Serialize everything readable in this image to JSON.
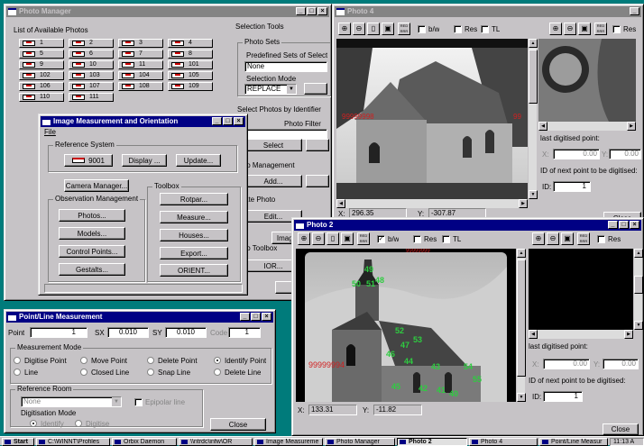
{
  "photo_manager": {
    "title": "Photo Manager",
    "list_label": "List of Available Photos",
    "photos": [
      "1",
      "2",
      "3",
      "4",
      "5",
      "6",
      "7",
      "8",
      "9",
      "10",
      "11",
      "101",
      "102",
      "103",
      "104",
      "105",
      "106",
      "107",
      "108",
      "109",
      "110",
      "111"
    ],
    "selection_tools": "Selection Tools",
    "photo_sets": "Photo Sets",
    "predefined": "Predefined Sets of Selected",
    "none_value": "None",
    "selection_mode": "Selection Mode",
    "mode_value": "REPLACE",
    "select_by_id": "Select Photos by Identifier",
    "photo_filter": "Photo Filter",
    "select_btn": "Select",
    "to_management": "to Management",
    "add_btn": "Add...",
    "ate_photo": "ate Photo",
    "edit_btn": "Edit...",
    "image_btn": "Image",
    "to_toolbox": "to Toolbox",
    "ior_btn": "IOR..."
  },
  "imo": {
    "title": "Image Measurement and Orientation",
    "menu_file": "File",
    "reference_system": "Reference System",
    "ref_id": "9001",
    "display_btn": "Display ...",
    "update_btn": "Update...",
    "camera_btn": "Camera Manager...",
    "toolbox": "Toolbox",
    "obs_mgmt": "Observation Management",
    "photos_btn": "Photos...",
    "models_btn": "Models...",
    "control_btn": "Control Points...",
    "gestalts_btn": "Gestalts...",
    "rotpar_btn": "Rotpar...",
    "measure_btn": "Measure...",
    "houses_btn": "Houses...",
    "export_btn": "Export...",
    "orient_btn": "ORIENT..."
  },
  "plm": {
    "title": "Point/Line Measurement",
    "point_label": "Point",
    "point_value": "1",
    "sx_label": "SX",
    "sx_value": "0.010",
    "sy_label": "SY",
    "sy_value": "0.010",
    "code_label": "Code",
    "code_value": "1",
    "meas_mode": "Measurement Mode",
    "modes": [
      "Digitise Point",
      "Move Point",
      "Delete Point",
      "Identify Point",
      "Line",
      "Closed Line",
      "Snap Line",
      "Delete Line"
    ],
    "ref_room": "Reference Room",
    "none_value": "None",
    "epipolar": "Epipolar line",
    "dig_mode": "Digitisation Mode",
    "identify": "Identify",
    "digitise": "Digitise",
    "close_btn": "Close"
  },
  "photo4": {
    "title": "Photo 4",
    "bw": "b/w",
    "res": "Res",
    "tl": "TL",
    "x_label": "X:",
    "x_value": "296.35",
    "y_label": "Y:",
    "y_value": "-307.87",
    "last_pt": "last digitised point:",
    "x0": "0.00",
    "y0": "0.00",
    "next_pt": "ID of next point to be digitised:",
    "id_label": "ID:",
    "id_value": "1",
    "close_btn": "Close",
    "marker_99": "99",
    "marker_red": "99999998"
  },
  "photo2": {
    "title": "Photo 2",
    "bw": "b/w",
    "res": "Res",
    "tl": "TL",
    "x_label": "X:",
    "x_value": "133.31",
    "y_label": "Y:",
    "y_value": "-11.82",
    "last_pt": "last digitised point:",
    "x0": "0.00",
    "y0": "0.00",
    "next_pt": "ID of next point to be digitised:",
    "id_label": "ID:",
    "id_value": "1",
    "close_btn": "Close",
    "marker_top": "99999999",
    "marker_left": "99999994",
    "green_labels": [
      "49",
      "50",
      "51",
      "48",
      "52",
      "47",
      "53",
      "46",
      "44",
      "43",
      "45",
      "42",
      "41",
      "40",
      "54",
      "55"
    ]
  },
  "taskbar": {
    "start": "Start",
    "items": [
      "C:\\WINNT\\Profiles",
      "Orbix Daemon",
      "\\\\ntrdc\\infw\\OR",
      "Image Measureme",
      "Photo Manager",
      "Photo 2",
      "Photo 4",
      "Point/Line Measur"
    ],
    "clock": "11:13 A"
  },
  "colors": {
    "desktop": "#007b7b",
    "title_active": "#000084",
    "title_inactive": "#848484",
    "marker_green": "#2ecc40",
    "marker_red": "#d02020"
  }
}
